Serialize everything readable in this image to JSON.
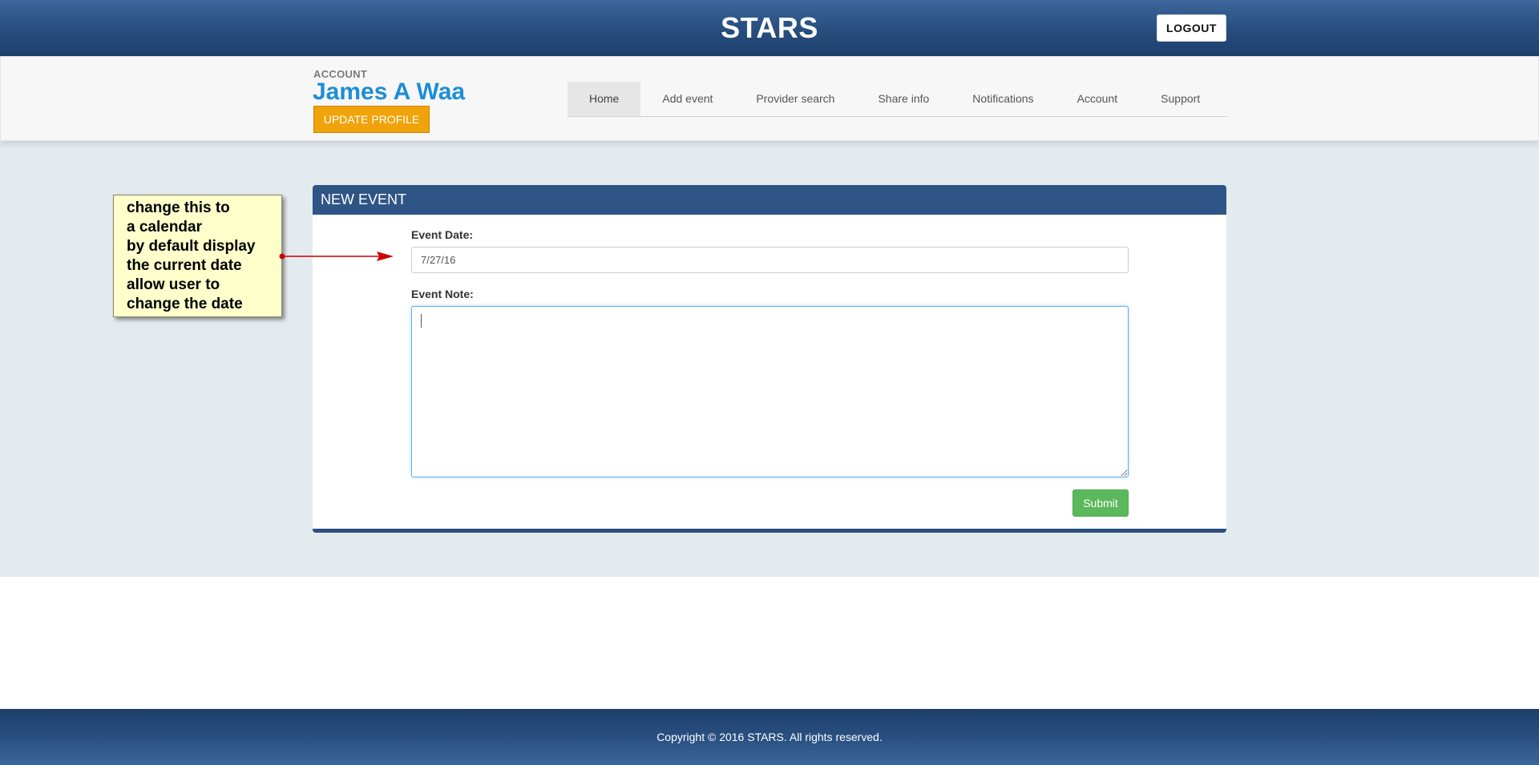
{
  "app": {
    "brand": "STARS",
    "logout_label": "LOGOUT"
  },
  "account": {
    "label": "ACCOUNT",
    "name": "James A Waa",
    "update_profile_label": "UPDATE PROFILE"
  },
  "nav": {
    "tabs": [
      {
        "label": "Home",
        "active": true
      },
      {
        "label": "Add event",
        "active": false
      },
      {
        "label": "Provider search",
        "active": false
      },
      {
        "label": "Share info",
        "active": false
      },
      {
        "label": "Notifications",
        "active": false
      },
      {
        "label": "Account",
        "active": false
      },
      {
        "label": "Support",
        "active": false
      }
    ]
  },
  "form": {
    "heading": "NEW EVENT",
    "date_label": "Event Date:",
    "date_value": "7/27/16",
    "note_label": "Event Note:",
    "note_value": "",
    "submit_label": "Submit"
  },
  "annotation": {
    "lines": [
      "change this to",
      "a calendar",
      "by default display",
      "the current date",
      "allow user to",
      "change the date"
    ],
    "arrow_icon": "red-arrow-icon"
  },
  "footer": {
    "copyright": "Copyright © 2016 STARS. All rights reserved."
  },
  "colors": {
    "header_blue": "#2a5183",
    "accent_blue": "#1e8dd6",
    "update_orange": "#f0a30a",
    "submit_green": "#5cb85c",
    "callout_yellow": "#ffffcc",
    "arrow_red": "#cc0000"
  }
}
